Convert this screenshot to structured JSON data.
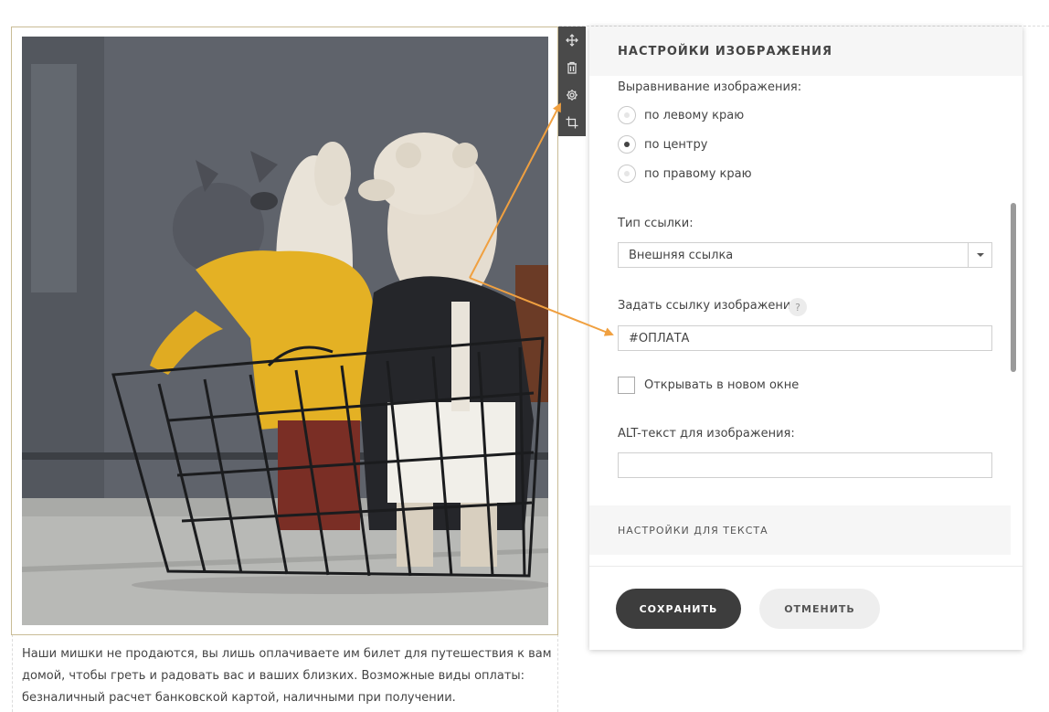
{
  "canvas": {
    "caption": [
      "Наши мишки не продаются, вы лишь оплачиваете им билет для путешествия к вам",
      "домой, чтобы греть и радовать вас и ваших близких. Возможные виды оплаты:",
      "безналичный расчет банковской картой, наличными при получении."
    ]
  },
  "toolbar": {
    "icons": [
      "move-icon",
      "trash-icon",
      "gear-icon",
      "crop-icon"
    ]
  },
  "panel": {
    "title": "НАСТРОЙКИ ИЗОБРАЖЕНИЯ",
    "alignment": {
      "label": "Выравнивание изображения:",
      "options": [
        "по левому краю",
        "по центру",
        "по правому краю"
      ],
      "selected": "по центру"
    },
    "link_type": {
      "label": "Тип ссылки:",
      "value": "Внешняя ссылка"
    },
    "link": {
      "label": "Задать ссылку изображению:",
      "help": "?",
      "value": "#ОПЛАТА"
    },
    "new_window": {
      "label": "Открывать в новом окне",
      "checked": false
    },
    "alt": {
      "label": "ALT-текст для изображения:",
      "value": ""
    },
    "text_settings": "НАСТРОЙКИ ДЛЯ ТЕКСТА",
    "save": "СОХРАНИТЬ",
    "cancel": "ОТМЕНИТЬ"
  },
  "colors": {
    "accent_arrow": "#f0a040",
    "frame": "#c9bc96",
    "toolbar": "#4a4a4a",
    "save_button": "#3d3d3d"
  }
}
